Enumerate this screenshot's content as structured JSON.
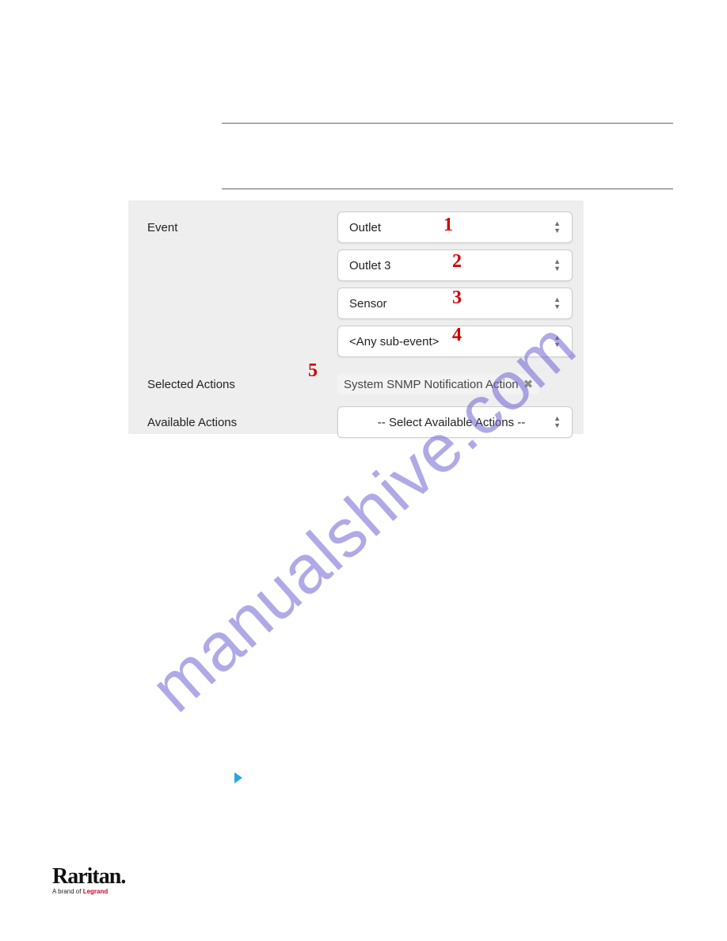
{
  "rules": {
    "top": true,
    "mid": true
  },
  "form": {
    "event_label": "Event",
    "selects": [
      {
        "value": "Outlet",
        "callout": "1"
      },
      {
        "value": "Outlet 3",
        "callout": "2"
      },
      {
        "value": "Sensor",
        "callout": "3"
      },
      {
        "value": "<Any sub-event>",
        "callout": "4"
      }
    ],
    "selected_actions_label": "Selected Actions",
    "selected_action_chip": "System SNMP Notification Action",
    "selected_actions_callout": "5",
    "available_actions_label": "Available Actions",
    "available_actions_placeholder": "-- Select Available Actions --"
  },
  "callout_numbers": [
    "1",
    "2",
    "3",
    "4",
    "5"
  ],
  "bullet_marker": true,
  "watermark": "manualshive.com",
  "footer": {
    "brand": "Raritan.",
    "tagline_prefix": "A brand of ",
    "tagline_accent": "Legrand"
  }
}
